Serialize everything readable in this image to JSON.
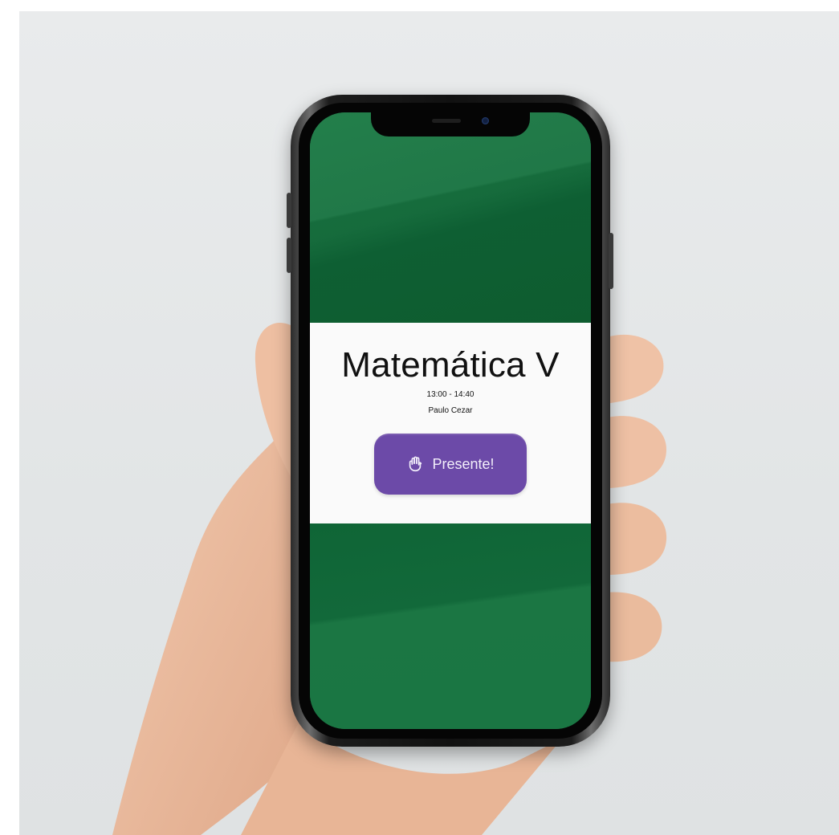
{
  "class_card": {
    "title": "Matemática V",
    "time": "13:00 - 14:40",
    "teacher": "Paulo Cezar"
  },
  "present_button": {
    "label": "Presente!",
    "icon": "raised-hand-icon"
  },
  "colors": {
    "screen_green": "#1b7340",
    "card_background": "#fafafa",
    "button_purple": "#6c4aa8"
  }
}
